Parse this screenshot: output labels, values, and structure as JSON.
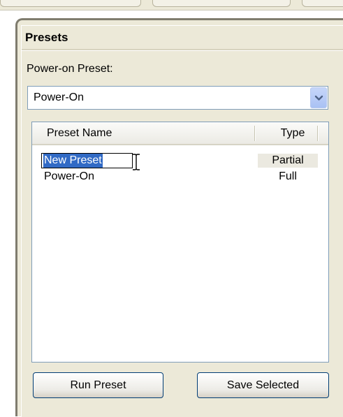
{
  "panel": {
    "title": "Presets"
  },
  "power_on": {
    "label": "Power-on Preset:",
    "selected": "Power-On",
    "dropdown_icon": "chevron-down-icon"
  },
  "preset_list": {
    "columns": [
      "Preset Name",
      "Type"
    ],
    "rows": [
      {
        "name": "New Preset",
        "type": "Partial",
        "selected": true,
        "editing": true
      },
      {
        "name": "Power-On",
        "type": "Full",
        "selected": false,
        "editing": false
      }
    ]
  },
  "buttons": {
    "run": "Run Preset",
    "save": "Save Selected"
  },
  "colors": {
    "panel_bg": "#ece9d8",
    "selection": "#316ac5",
    "border": "#7f9db9"
  }
}
